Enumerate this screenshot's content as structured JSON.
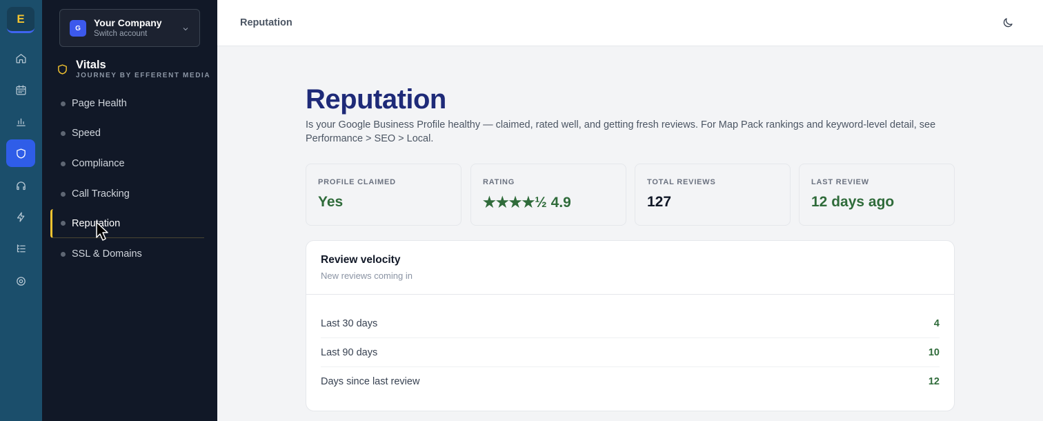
{
  "rail": {
    "logo": "E",
    "items": [
      {
        "icon": "home-icon"
      },
      {
        "icon": "calendar-icon"
      },
      {
        "icon": "bar-chart-icon"
      },
      {
        "icon": "shield-icon",
        "active": true
      },
      {
        "icon": "headset-icon"
      },
      {
        "icon": "bolt-icon"
      },
      {
        "icon": "list-tree-icon"
      },
      {
        "icon": "settings-icon"
      }
    ]
  },
  "account": {
    "avatar": "G",
    "name": "Your Company",
    "sub": "Switch account"
  },
  "section": {
    "title": "Vitals",
    "subtitle": "JOURNEY BY EFFERENT MEDIA"
  },
  "nav": {
    "items": [
      {
        "label": "Page Health"
      },
      {
        "label": "Speed"
      },
      {
        "label": "Compliance"
      },
      {
        "label": "Call Tracking"
      },
      {
        "label": "Reputation",
        "active": true
      },
      {
        "label": "SSL & Domains"
      }
    ]
  },
  "topbar": {
    "title": "Reputation"
  },
  "page": {
    "title": "Reputation",
    "description": "Is your Google Business Profile healthy — claimed, rated well, and getting fresh reviews. For Map Pack rankings and keyword-level detail, see Performance > SEO > Local."
  },
  "stats": [
    {
      "label": "PROFILE CLAIMED",
      "value": "Yes"
    },
    {
      "label": "RATING",
      "value": "★★★★½ 4.9"
    },
    {
      "label": "TOTAL REVIEWS",
      "value": "127"
    },
    {
      "label": "LAST REVIEW",
      "value": "12 days ago"
    }
  ],
  "velocity": {
    "title": "Review velocity",
    "subtitle": "New reviews coming in",
    "rows": [
      {
        "label": "Last 30 days",
        "value": "4"
      },
      {
        "label": "Last 90 days",
        "value": "10"
      },
      {
        "label": "Days since last review",
        "value": "12"
      }
    ]
  },
  "colors": {
    "rail": "#1b4e6b",
    "sidebar": "#111827",
    "accent": "#f4c430",
    "active": "#2f5de8",
    "heading": "#1e2a78",
    "positive": "#2f6b3a"
  }
}
